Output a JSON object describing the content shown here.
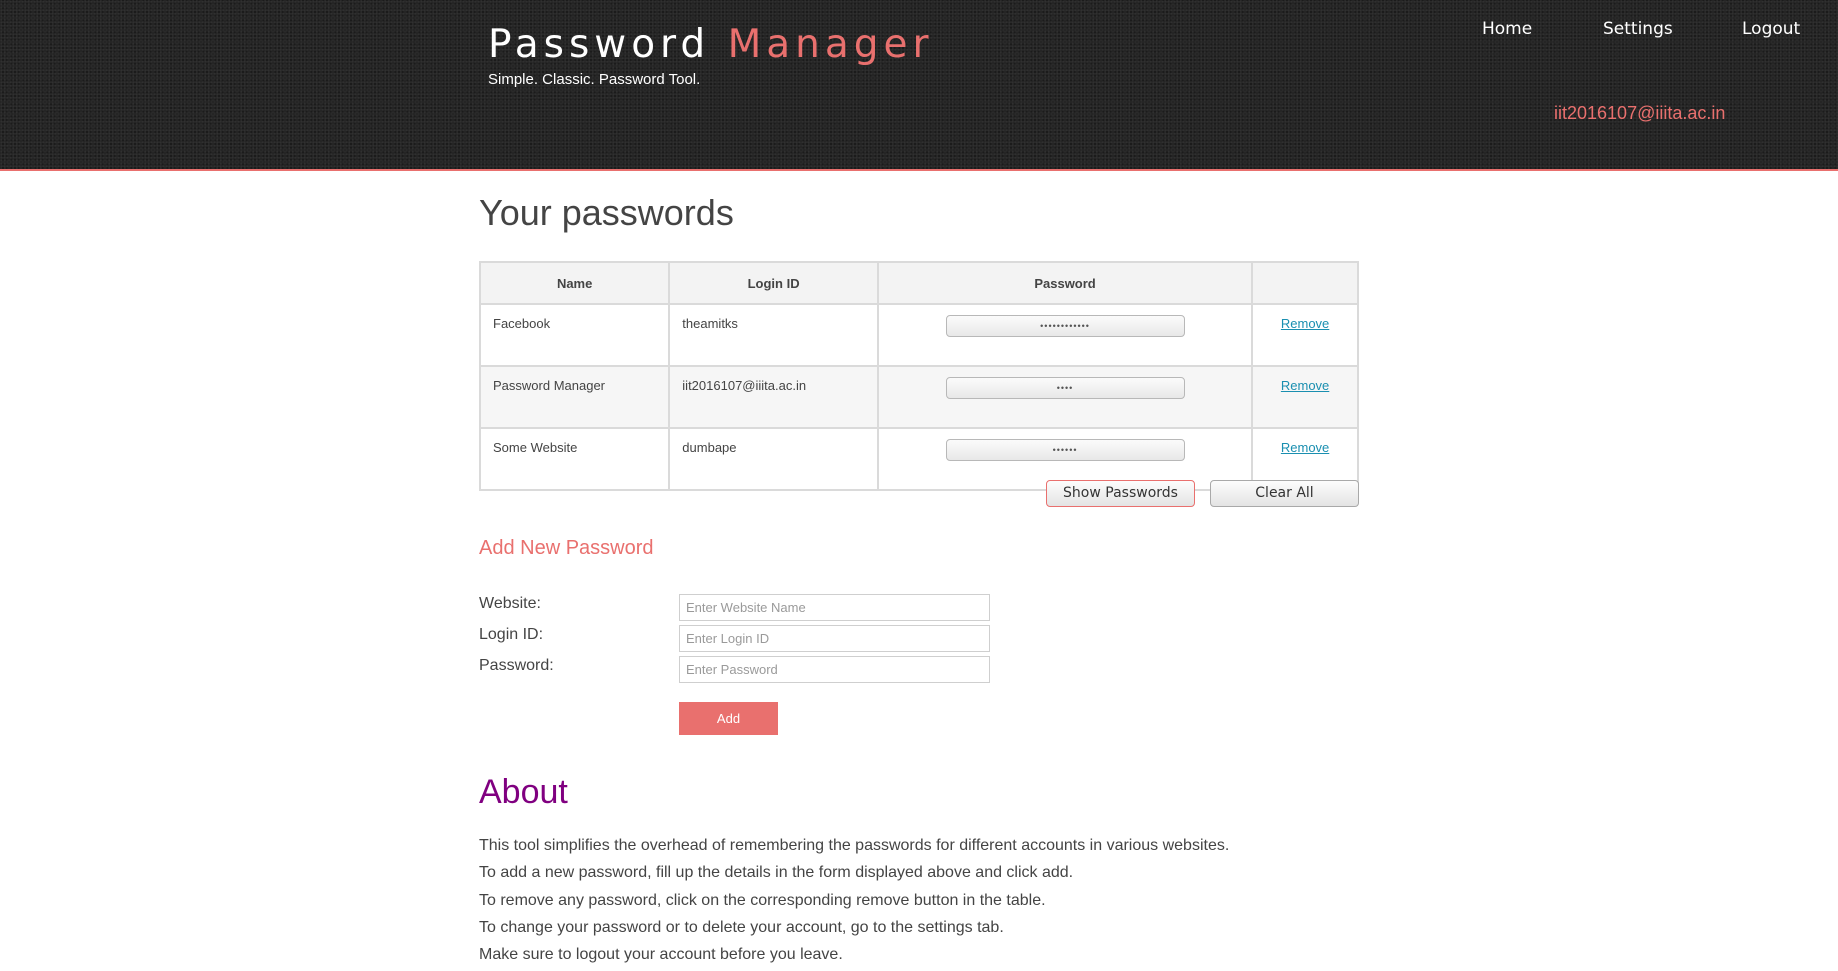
{
  "header": {
    "title_part1": "Password",
    "title_part2": "Manager",
    "tagline": "Simple. Classic. Password Tool.",
    "user_email": "iit2016107@iiita.ac.in"
  },
  "nav": {
    "items": [
      {
        "label": "Home"
      },
      {
        "label": "Settings"
      },
      {
        "label": "Logout"
      }
    ]
  },
  "passwords": {
    "title": "Your passwords",
    "columns": [
      "Name",
      "Login ID",
      "Password",
      ""
    ],
    "rows": [
      {
        "name": "Facebook",
        "login_id": "theamitks",
        "password_masked": "••••••••••••",
        "action": "Remove"
      },
      {
        "name": "Password Manager",
        "login_id": "iit2016107@iiita.ac.in",
        "password_masked": "••••",
        "action": "Remove"
      },
      {
        "name": "Some Website",
        "login_id": "dumbape",
        "password_masked": "••••••",
        "action": "Remove"
      }
    ],
    "show_button": "Show Passwords",
    "clear_button": "Clear All"
  },
  "add_form": {
    "title": "Add New Password",
    "website_label": "Website:",
    "website_placeholder": "Enter Website Name",
    "login_label": "Login ID:",
    "login_placeholder": "Enter Login ID",
    "password_label": "Password:",
    "password_placeholder": "Enter Password",
    "add_button": "Add"
  },
  "about": {
    "title": "About",
    "lines": [
      "This tool simplifies the overhead of remembering the passwords for different accounts in various websites.",
      "To add a new password, fill up the details in the form displayed above and click add.",
      "To remove any password, click on the corresponding remove button in the table.",
      "To change your password or to delete your account, go to the settings tab.",
      "Make sure to logout your account before you leave."
    ]
  },
  "colors": {
    "accent": "#e9706e",
    "header_bg": "#252525",
    "about_title": "#800080",
    "link": "#1a8fb0"
  }
}
